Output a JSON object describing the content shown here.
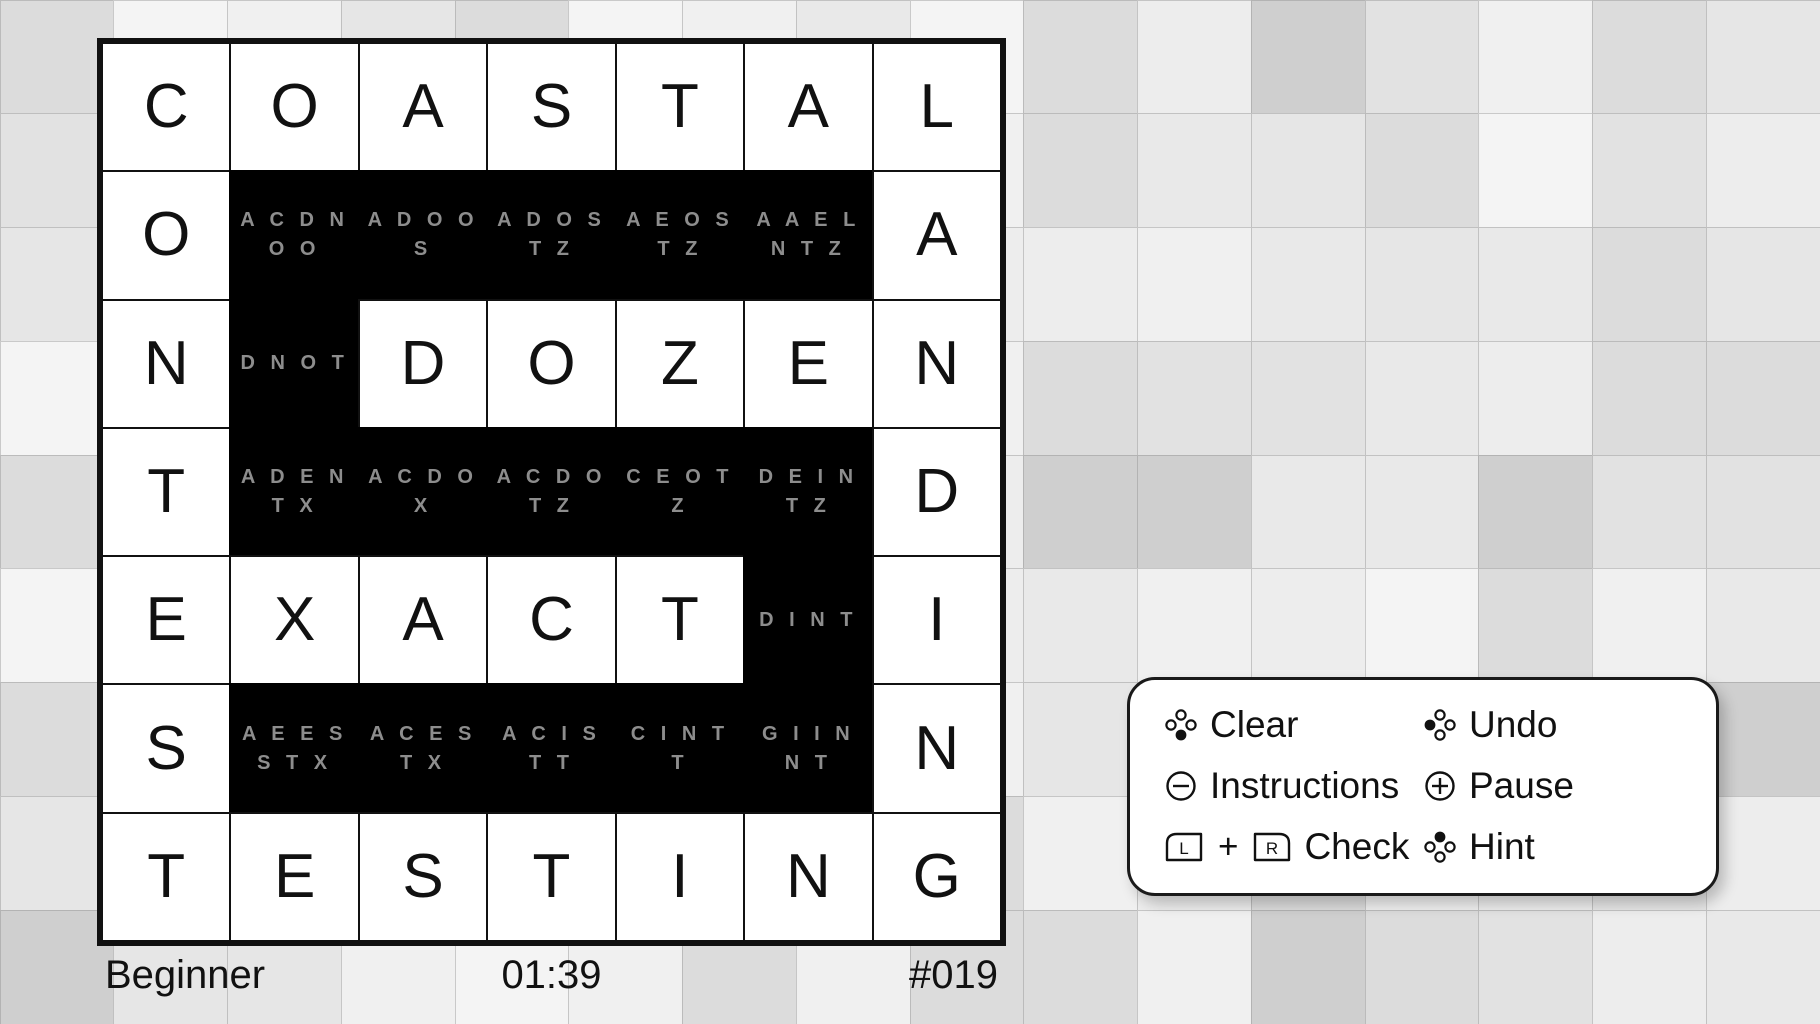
{
  "board": {
    "rows": [
      [
        {
          "type": "letter",
          "value": "C"
        },
        {
          "type": "letter",
          "value": "O"
        },
        {
          "type": "letter",
          "value": "A"
        },
        {
          "type": "letter",
          "value": "S"
        },
        {
          "type": "letter",
          "value": "T"
        },
        {
          "type": "letter",
          "value": "A"
        },
        {
          "type": "letter",
          "value": "L"
        }
      ],
      [
        {
          "type": "letter",
          "value": "O"
        },
        {
          "type": "blocked",
          "value": "ACDNOO"
        },
        {
          "type": "blocked",
          "value": "ADOOS"
        },
        {
          "type": "blocked",
          "value": "ADOSTZ"
        },
        {
          "type": "blocked",
          "value": "AEOSTZ"
        },
        {
          "type": "blocked",
          "value": "AAELNTZ"
        },
        {
          "type": "letter",
          "value": "A"
        }
      ],
      [
        {
          "type": "letter",
          "value": "N"
        },
        {
          "type": "blocked",
          "value": "DNOT"
        },
        {
          "type": "letter",
          "value": "D"
        },
        {
          "type": "letter",
          "value": "O"
        },
        {
          "type": "letter",
          "value": "Z"
        },
        {
          "type": "letter",
          "value": "E"
        },
        {
          "type": "letter",
          "value": "N"
        }
      ],
      [
        {
          "type": "letter",
          "value": "T"
        },
        {
          "type": "blocked",
          "value": "ADENTX"
        },
        {
          "type": "blocked",
          "value": "ACDOX"
        },
        {
          "type": "blocked",
          "value": "ACDOTZ"
        },
        {
          "type": "blocked",
          "value": "CEOTZ"
        },
        {
          "type": "blocked",
          "value": "DEINTZ"
        },
        {
          "type": "letter",
          "value": "D"
        }
      ],
      [
        {
          "type": "letter",
          "value": "E"
        },
        {
          "type": "letter",
          "value": "X"
        },
        {
          "type": "letter",
          "value": "A"
        },
        {
          "type": "letter",
          "value": "C"
        },
        {
          "type": "letter",
          "value": "T"
        },
        {
          "type": "blocked",
          "value": "DINT"
        },
        {
          "type": "letter",
          "value": "I"
        }
      ],
      [
        {
          "type": "letter",
          "value": "S"
        },
        {
          "type": "blocked",
          "value": "AEESSTX"
        },
        {
          "type": "blocked",
          "value": "ACESTX"
        },
        {
          "type": "blocked",
          "value": "ACISTT"
        },
        {
          "type": "blocked",
          "value": "CINTT"
        },
        {
          "type": "blocked",
          "value": "GIINNT"
        },
        {
          "type": "letter",
          "value": "N"
        }
      ],
      [
        {
          "type": "letter",
          "value": "T"
        },
        {
          "type": "letter",
          "value": "E"
        },
        {
          "type": "letter",
          "value": "S"
        },
        {
          "type": "letter",
          "value": "T"
        },
        {
          "type": "letter",
          "value": "I"
        },
        {
          "type": "letter",
          "value": "N"
        },
        {
          "type": "letter",
          "value": "G"
        }
      ]
    ]
  },
  "status": {
    "difficulty": "Beginner",
    "timer": "01:39",
    "puzzle_number": "#019"
  },
  "controls": {
    "items": [
      {
        "label": "Clear",
        "icon": "button-a-icon"
      },
      {
        "label": "Undo",
        "icon": "button-y-icon"
      },
      {
        "label": "Instructions",
        "icon": "minus-circle-icon"
      },
      {
        "label": "Pause",
        "icon": "plus-circle-icon"
      },
      {
        "label": "Check",
        "icon": "shoulder-lr-icon"
      },
      {
        "label": "Hint",
        "icon": "button-x-icon"
      }
    ],
    "check_left_key": "L",
    "check_right_key": "R",
    "check_combo_separator": "+"
  },
  "colors": {
    "blocked_cell": "#000000",
    "cell_border": "#111111",
    "pencil_text": "#8d8d8d",
    "letter_text": "#111111",
    "panel_background": "#ffffff"
  }
}
